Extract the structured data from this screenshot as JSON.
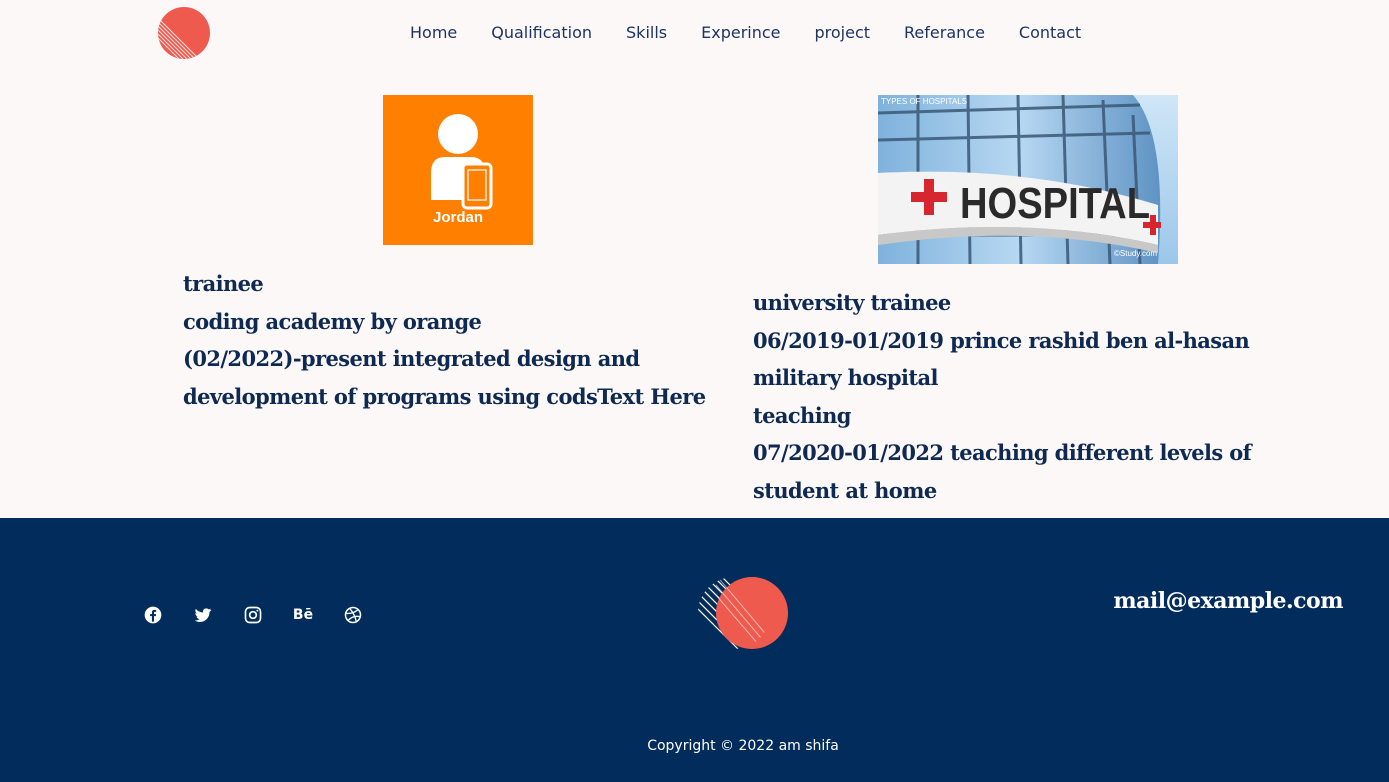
{
  "nav": {
    "items": [
      "Home",
      "Qualification",
      "Skills",
      "Experince",
      "project",
      "Referance",
      "Contact"
    ]
  },
  "cards": {
    "orange_logo_text": "Jordan",
    "hospital_caption": "TYPES OF HOSPITALS",
    "hospital_sign": "HOSPITAL",
    "hospital_watermark": "©Study.com"
  },
  "left": {
    "lines": [
      "trainee",
      "coding academy by orange",
      "(02/2022)-present integrated design and development of programs using codsText Here"
    ]
  },
  "right": {
    "lines": [
      "university trainee",
      "06/2019-01/2019 prince rashid ben al-hasan military hospital",
      "teaching",
      "07/2020-01/2022 teaching different levels of student at home"
    ]
  },
  "footer": {
    "email": "mail@example.com",
    "copyright": "Copyright © 2022 am shifa",
    "behance_label": "Bē",
    "socials": [
      "facebook-icon",
      "twitter-icon",
      "instagram-icon",
      "behance-icon",
      "dribbble-icon"
    ]
  },
  "colors": {
    "background": "#fdf8f8",
    "text_navy": "#0e2a52",
    "footer_bg": "#022c5b",
    "accent_orange": "#ff7f00",
    "logo_red": "#ef5a4f"
  }
}
